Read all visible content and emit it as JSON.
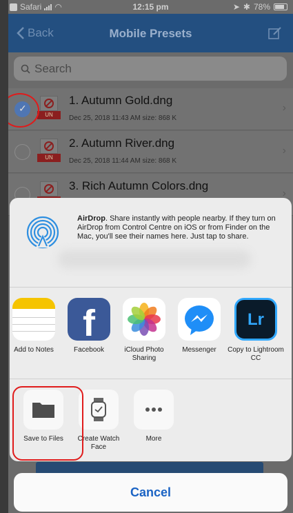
{
  "status_bar": {
    "carrier": "Safari",
    "time": "12:15 pm",
    "battery": "78%"
  },
  "nav": {
    "back_label": "Back",
    "title": "Mobile Presets"
  },
  "search": {
    "placeholder": "Search"
  },
  "files": [
    {
      "name": "1. Autumn Gold.dng",
      "meta": "Dec 25, 2018 11:43 AM  size: 868 K",
      "selected": true,
      "badge": "UN"
    },
    {
      "name": "2. Autumn River.dng",
      "meta": "Dec 25, 2018 11:44 AM  size: 868 K",
      "selected": false,
      "badge": "UN"
    },
    {
      "name": "3. Rich Autumn Colors.dng",
      "meta": "",
      "selected": false,
      "badge": "UN"
    }
  ],
  "share_sheet": {
    "airdrop": {
      "title": "AirDrop",
      "text": ". Share instantly with people nearby. If they turn on AirDrop from Control Centre on iOS or from Finder on the Mac, you'll see their names here. Just tap to share."
    },
    "apps": [
      {
        "label": "Add to Notes",
        "icon": "notes-icon"
      },
      {
        "label": "Facebook",
        "icon": "facebook-icon"
      },
      {
        "label": "iCloud Photo Sharing",
        "icon": "photos-icon"
      },
      {
        "label": "Messenger",
        "icon": "messenger-icon"
      },
      {
        "label": "Copy to Lightroom CC",
        "icon": "lightroom-icon",
        "icon_text": "Lr"
      }
    ],
    "actions": [
      {
        "label": "Save to Files",
        "icon": "folder-icon"
      },
      {
        "label": "Create Watch Face",
        "icon": "watch-icon"
      },
      {
        "label": "More",
        "icon": "more-icon"
      }
    ],
    "cancel_label": "Cancel"
  },
  "colors": {
    "nav_bar": "#234f80",
    "cancel_text": "#1a63c4",
    "annotation_red": "#e01b1b"
  }
}
